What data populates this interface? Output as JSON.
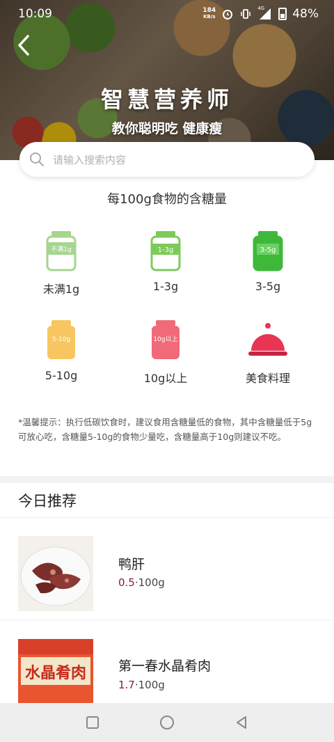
{
  "status_bar": {
    "time": "10:09",
    "data_speed_top": "184",
    "data_speed_unit": "KB/s",
    "signal_label": "4G",
    "battery": "48%"
  },
  "hero": {
    "title": "智慧营养师",
    "subtitle": "教你聪明吃 健康瘦"
  },
  "search": {
    "placeholder": "请输入搜索内容"
  },
  "section": {
    "title": "每100g食物的含糖量"
  },
  "categories": [
    {
      "label": "未满1g",
      "jar_text": "不满1g",
      "color": "#a6d58f"
    },
    {
      "label": "1-3g",
      "jar_text": "1-3g",
      "color": "#7ccb5a"
    },
    {
      "label": "3-5g",
      "jar_text": "3-5g",
      "color": "#3fb83a"
    },
    {
      "label": "5-10g",
      "jar_text": "5-10g",
      "color": "#f7c660"
    },
    {
      "label": "10g以上",
      "jar_text": "10g以上",
      "color": "#f16a78"
    },
    {
      "label": "美食料理",
      "jar_text": "",
      "color": "#e83553"
    }
  ],
  "tip": {
    "text": "*温馨提示：执行低碳饮食时，建议食用含糖量低的食物，其中含糖量低于5g可放心吃，含糖量5-10g的食物少量吃，含糖量高于10g则建议不吃。"
  },
  "recommend": {
    "title": "今日推荐",
    "items": [
      {
        "name": "鸭肝",
        "sugar": "0.5",
        "unit": "·100g"
      },
      {
        "name": "第一春水晶肴肉",
        "sugar": "1.7",
        "unit": "·100g",
        "package_text": "水晶肴肉"
      }
    ]
  },
  "colors": {
    "accent_value": "#8b1a3a",
    "nav_bg": "#eeeeee"
  }
}
